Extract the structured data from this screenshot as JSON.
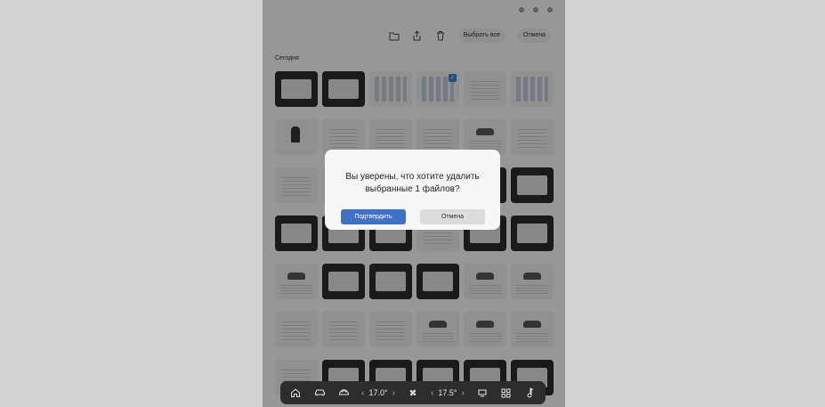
{
  "toolbar": {
    "select_all_label": "Выбрать все",
    "cancel_label": "Отмена"
  },
  "section": {
    "title": "Сегодня"
  },
  "dialog": {
    "message_line1": "Вы уверены, что хотите удалить",
    "message_line2": "выбранные 1 файлов?",
    "confirm_label": "Подтвердить",
    "cancel_label": "Отмена"
  },
  "dock": {
    "left_temp": "17.0°",
    "right_temp": "17.5°"
  },
  "thumbnails": [
    "dark",
    "dark",
    "grid-ui",
    "grid-ui-checked",
    "doc",
    "grid-ui",
    "person",
    "doc",
    "doc",
    "doc",
    "car",
    "doc",
    "doc",
    "doc",
    "doc",
    "doc",
    "dark",
    "dark",
    "dark",
    "dark",
    "dark",
    "doc",
    "dark",
    "dark",
    "car",
    "dark",
    "dark",
    "dark",
    "car",
    "car",
    "doc",
    "doc",
    "doc",
    "car",
    "car",
    "car",
    "doc",
    "dark",
    "dark",
    "dark",
    "dark",
    "dark"
  ],
  "colors": {
    "accent": "#3f72c6",
    "dock": "#2d2d2d"
  }
}
